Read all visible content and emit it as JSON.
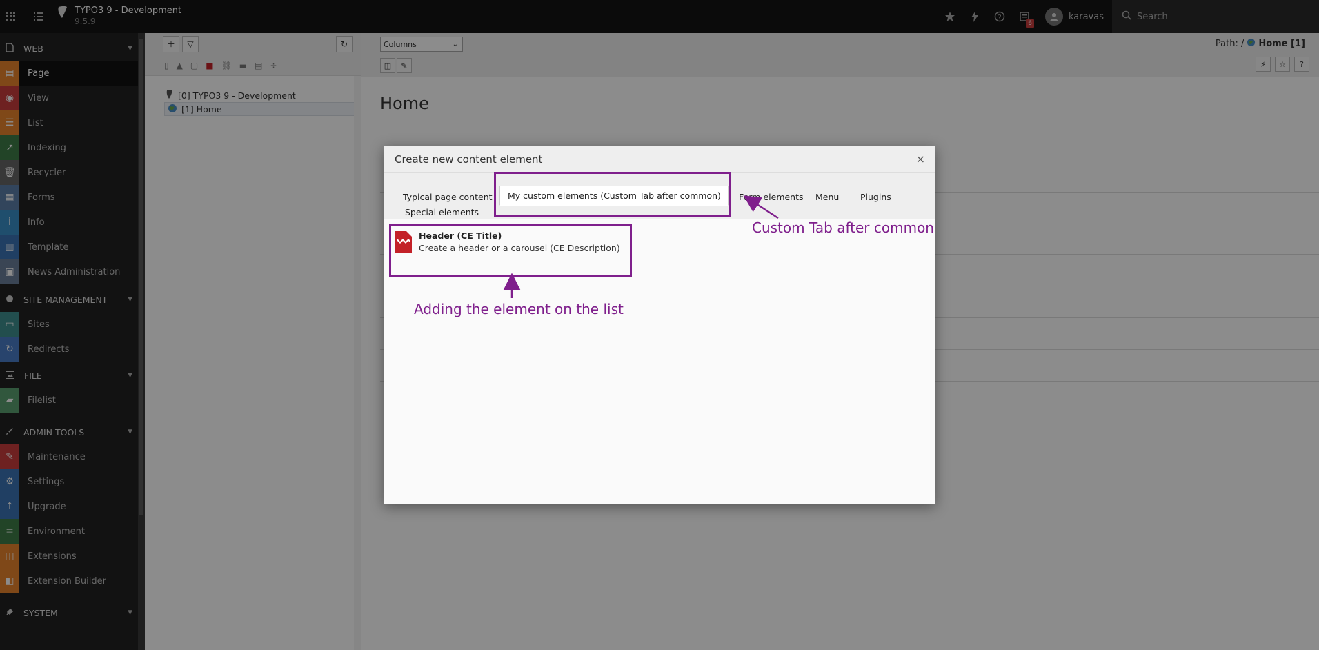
{
  "topbar": {
    "site_title": "TYPO3 9 - Development",
    "site_version": "9.5.9",
    "notification_count": "6",
    "username": "karavas",
    "search_placeholder": "Search"
  },
  "module_menu": {
    "groups": [
      {
        "label": "WEB",
        "items": [
          "Page",
          "View",
          "List",
          "Indexing",
          "Recycler",
          "Forms",
          "Info",
          "Template",
          "News Administration"
        ]
      },
      {
        "label": "SITE MANAGEMENT",
        "items": [
          "Sites",
          "Redirects"
        ]
      },
      {
        "label": "FILE",
        "items": [
          "Filelist"
        ]
      },
      {
        "label": "ADMIN TOOLS",
        "items": [
          "Maintenance",
          "Settings",
          "Upgrade",
          "Environment",
          "Extensions",
          "Extension Builder"
        ]
      },
      {
        "label": "SYSTEM",
        "items": []
      }
    ],
    "colors": {
      "page": "#e8842d",
      "view": "#c83c3c",
      "list": "#e8842d",
      "indexing": "#3e7d47",
      "recycler": "#666666",
      "forms": "#5b7fa8",
      "info": "#3a8ec6",
      "template": "#3b74b4",
      "news": "#6a7e99",
      "sites": "#3e8e8e",
      "redirects": "#4a7cc6",
      "filelist": "#5a9e6f",
      "maintenance": "#c83c3c",
      "settings": "#3b74b4",
      "upgrade": "#3b74b4",
      "environment": "#3e7d47",
      "extensions": "#e8842d",
      "extension_builder": "#e8842d"
    }
  },
  "pagetree": {
    "root": "[0] TYPO3 9 - Development",
    "home": "[1] Home"
  },
  "docheader": {
    "view_select": "Columns",
    "path_prefix": "Path: /",
    "path_current": "Home [1]"
  },
  "page": {
    "heading": "Home"
  },
  "modal": {
    "title": "Create new content element",
    "close_glyph": "×",
    "tabs": [
      "Typical page content",
      "My custom elements (Custom Tab after common)",
      "Form elements",
      "Menu",
      "Plugins",
      "Special elements"
    ],
    "active_tab": 1,
    "items": [
      {
        "title": "Header (CE Title)",
        "description": "Create a header or a carousel (CE Description)"
      }
    ]
  },
  "annotations": {
    "tab_note": "Custom Tab after common",
    "item_note": "Adding the element on the list",
    "color": "#7f1f8c"
  }
}
